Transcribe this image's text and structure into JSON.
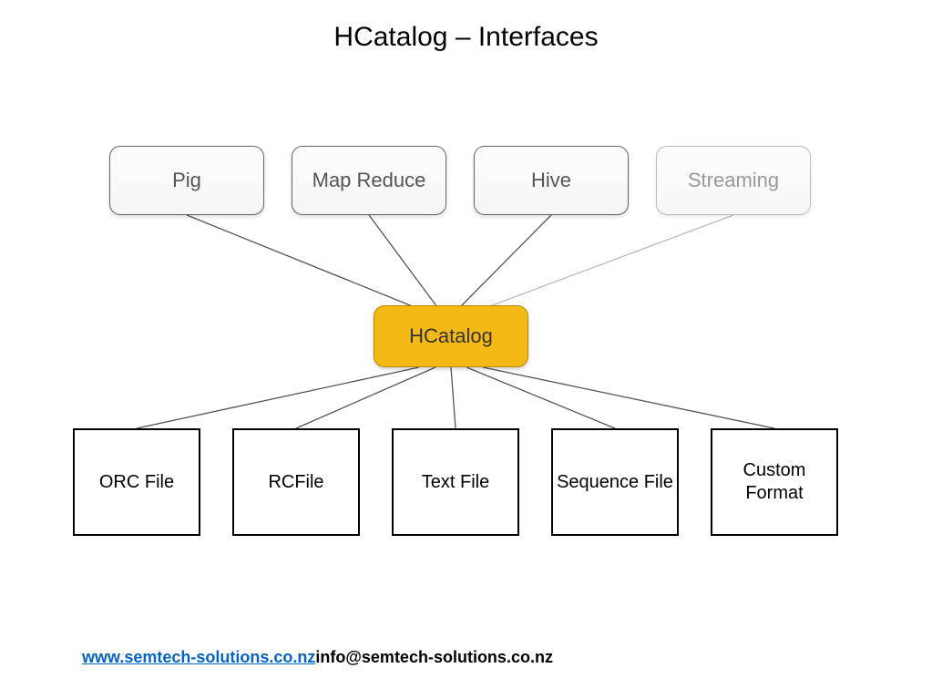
{
  "title": "HCatalog – Interfaces",
  "top_nodes": {
    "pig": "Pig",
    "map_reduce": "Map Reduce",
    "hive": "Hive",
    "streaming": "Streaming"
  },
  "center_node": "HCatalog",
  "bottom_nodes": {
    "orc": "ORC File",
    "rcfile": "RCFile",
    "text": "Text File",
    "sequence": "Sequence File",
    "custom": "Custom Format"
  },
  "footer": {
    "link_text": "www.semtech-solutions.co.nz",
    "email_text": "info@semtech-solutions.co.nz"
  }
}
